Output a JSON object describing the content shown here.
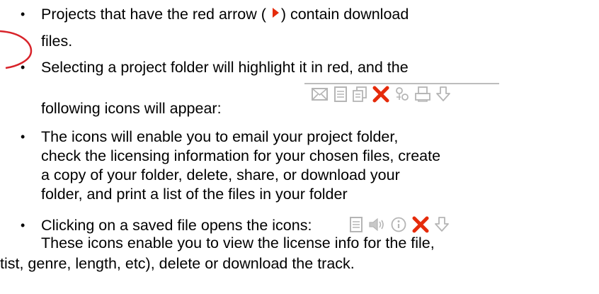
{
  "bullets": [
    {
      "lines": [
        "Projects that have the red arrow ( ",
        ") contain download",
        "files."
      ]
    },
    {
      "lines": [
        "Selecting a project folder will highlight it in red, and the",
        "following icons will appear:"
      ]
    },
    {
      "lines": [
        "The icons will enable you to email your project folder,",
        "check the licensing information for your chosen files, create",
        "a copy of your folder, delete, share, or download your",
        "folder, and print a list of the files in your folder"
      ]
    },
    {
      "lines": [
        "Clicking on a saved file opens the icons:",
        "These icons enable you to view the license info for the file,",
        "tist, genre, length, etc), delete or download the track."
      ]
    }
  ],
  "bullet_symbol": "•",
  "folder_icons": [
    "email-icon",
    "document-icon",
    "copy-icon",
    "delete-icon",
    "share-icon",
    "print-icon",
    "download-icon"
  ],
  "file_icons": [
    "document-icon",
    "audio-icon",
    "info-icon",
    "delete-icon",
    "download-icon"
  ],
  "colors": {
    "arrow": "#e52b0b",
    "delete": "#e52b0b",
    "icon_gray": "#b5b5b5",
    "oval": "#d8232a"
  }
}
